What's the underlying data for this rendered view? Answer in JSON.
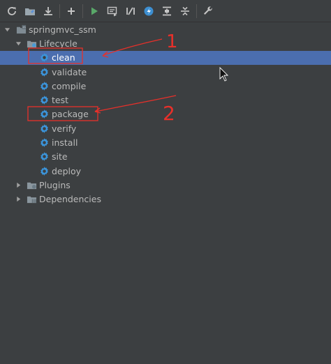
{
  "toolbar": {
    "buttons": [
      {
        "name": "reimport-icon"
      },
      {
        "name": "generate-sources-icon"
      },
      {
        "name": "download-icon"
      },
      {
        "name": "add-icon"
      },
      {
        "name": "run-icon"
      },
      {
        "name": "run-config-icon"
      },
      {
        "name": "toggle-offline-icon"
      },
      {
        "name": "skip-tests-icon"
      },
      {
        "name": "show-dependencies-icon"
      },
      {
        "name": "collapse-all-icon"
      },
      {
        "name": "settings-wrench-icon"
      }
    ]
  },
  "tree": {
    "project": "springmvc_ssm",
    "lifecycle": {
      "label": "Lifecycle",
      "goals": [
        "clean",
        "validate",
        "compile",
        "test",
        "package",
        "verify",
        "install",
        "site",
        "deploy"
      ],
      "selected": "clean"
    },
    "plugins": "Plugins",
    "dependencies": "Dependencies"
  },
  "annotations": {
    "color": "#e8302a",
    "labels": [
      "1",
      "2"
    ]
  }
}
